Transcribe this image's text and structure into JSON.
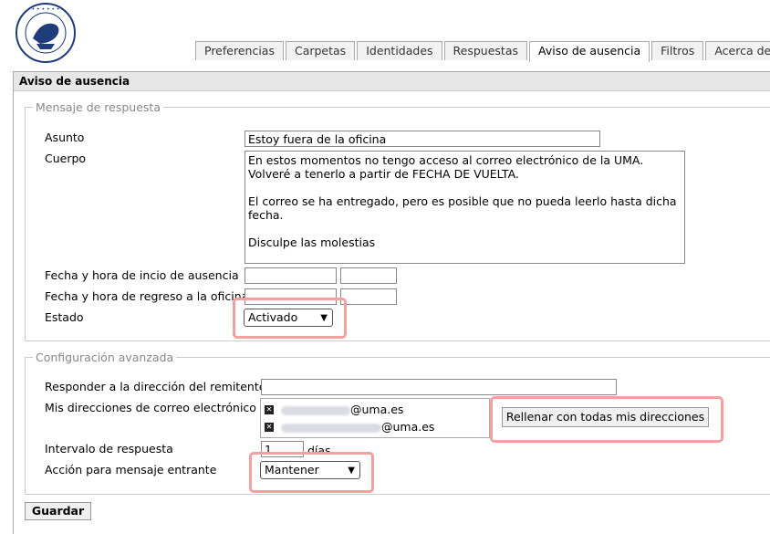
{
  "tabs": [
    "Preferencias",
    "Carpetas",
    "Identidades",
    "Respuestas",
    "Aviso de ausencia",
    "Filtros",
    "Acerca de"
  ],
  "panel_title": "Aviso de ausencia",
  "section1": {
    "legend": "Mensaje de respuesta",
    "subject_label": "Asunto",
    "subject_value": "Estoy fuera de la oficina",
    "body_label": "Cuerpo",
    "body_value": "En estos momentos no tengo acceso al correo electrónico de la UMA. Volveré a tenerlo a partir de FECHA DE VUELTA.\n\nEl correo se ha entregado, pero es posible que no pueda leerlo hasta dicha fecha.\n\nDisculpe las molestias",
    "start_label": "Fecha y hora de incio de ausencia",
    "return_label": "Fecha y hora de regreso a la oficina",
    "status_label": "Estado",
    "status_value": "Activado"
  },
  "section2": {
    "legend": "Configuración avanzada",
    "reply_to_label": "Responder a la dirección del remitente",
    "addresses_label": "Mis direcciones de correo electrónico",
    "addresses": [
      "@uma.es",
      "@uma.es"
    ],
    "fill_button": "Rellenar con todas mis direcciones",
    "interval_label": "Intervalo de respuesta",
    "interval_value": "1",
    "interval_unit": "días",
    "action_label": "Acción para mensaje entrante",
    "action_value": "Mantener"
  },
  "save_button": "Guardar",
  "icons": {
    "address_remove": "remove-x-icon",
    "logo": "university-seal-logo"
  },
  "colors": {
    "highlight": "#f4a0a0",
    "panel_header": "#e7e7e7"
  }
}
